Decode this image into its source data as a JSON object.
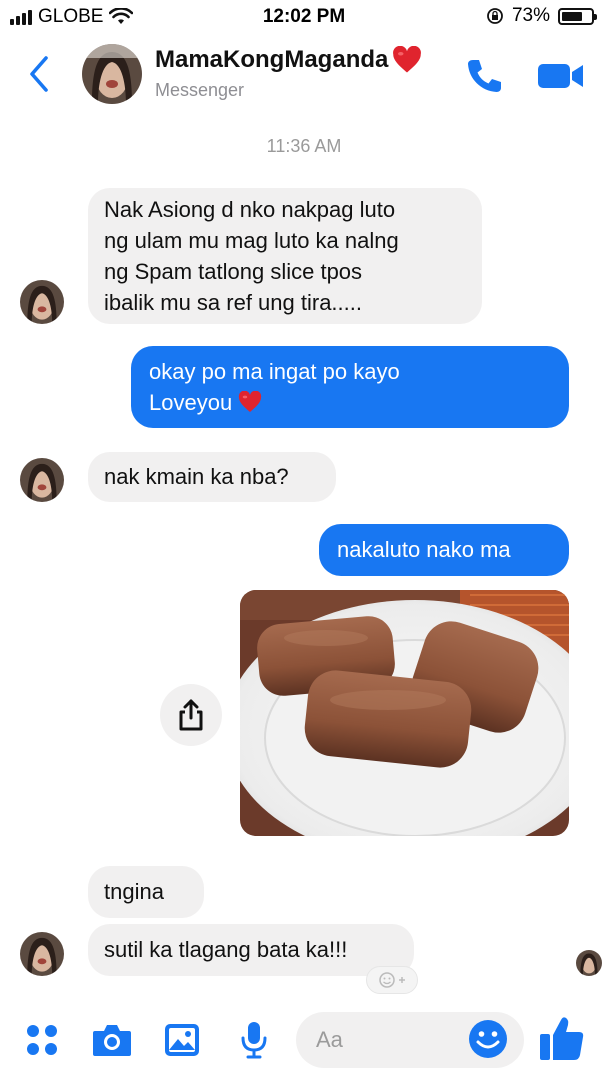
{
  "status_bar": {
    "carrier": "GLOBE",
    "time": "12:02 PM",
    "battery_percent": "73%",
    "battery_level": 0.73,
    "icons": [
      "signal-bars-icon",
      "wifi-icon",
      "orientation-lock-icon",
      "battery-icon"
    ]
  },
  "header": {
    "contact_name": "MamaKongMaganda",
    "subtitle": "Messenger",
    "icons": [
      "back-chevron-icon",
      "heart-emoji-icon",
      "phone-icon",
      "video-camera-icon"
    ]
  },
  "timestamp": "11:36 AM",
  "messages": [
    {
      "from": "contact",
      "lines": [
        "Nak Asiong d nko nakpag luto",
        "ng ulam mu mag luto ka nalng",
        "ng Spam tatlong slice tpos",
        "ibalik mu sa ref ung tira....."
      ]
    },
    {
      "from": "me",
      "lines": [
        "okay po ma ingat po kayo",
        "Loveyou"
      ],
      "emoji": "heart"
    },
    {
      "from": "contact",
      "lines": [
        "nak kmain ka nba?"
      ]
    },
    {
      "from": "me",
      "lines": [
        "nakaluto nako ma"
      ]
    },
    {
      "from": "me",
      "type": "photo",
      "description_icon": "spam-slices-photo"
    },
    {
      "from": "contact",
      "lines": [
        "tngina"
      ]
    },
    {
      "from": "contact",
      "lines": [
        "sutil ka tlagang bata ka!!!"
      ]
    }
  ],
  "composer": {
    "placeholder": "Aa",
    "icons": [
      "apps-grid-icon",
      "camera-icon",
      "gallery-icon",
      "microphone-icon",
      "emoji-smile-icon",
      "thumbs-up-icon"
    ]
  },
  "colors": {
    "accent": "#1877f2",
    "incoming_bubble": "#f1f0f0",
    "outgoing_bubble": "#1877f2",
    "secondary_text": "#8e8e93"
  }
}
